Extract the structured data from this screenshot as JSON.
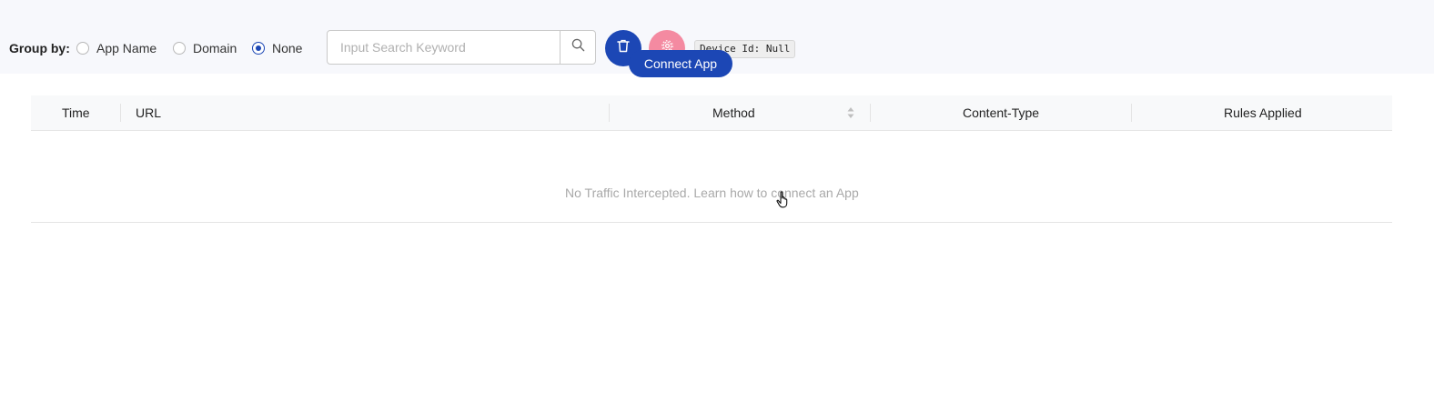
{
  "toolbar": {
    "group_by_label": "Group by:",
    "options": [
      {
        "label": "App Name",
        "checked": false
      },
      {
        "label": "Domain",
        "checked": false
      },
      {
        "label": "None",
        "checked": true
      }
    ],
    "search_placeholder": "Input Search Keyword",
    "search_value": "",
    "device_id": "Device Id: Null"
  },
  "icons": {
    "search": "search-icon",
    "delete": "trash-icon",
    "settings": "gear-icon",
    "sort": "sort-icon",
    "cursor": "hand-pointer-icon"
  },
  "colors": {
    "primary": "#1c47b5",
    "settings_button": "#f48aa1",
    "toolbar_bg": "#f7f8fc",
    "muted_text": "#a9a9a9"
  },
  "table": {
    "columns": [
      "Time",
      "URL",
      "Method",
      "Content-Type",
      "Rules Applied"
    ],
    "connect_label": "Connect App",
    "empty_text": "No Traffic Intercepted. Learn how to connect an App"
  }
}
